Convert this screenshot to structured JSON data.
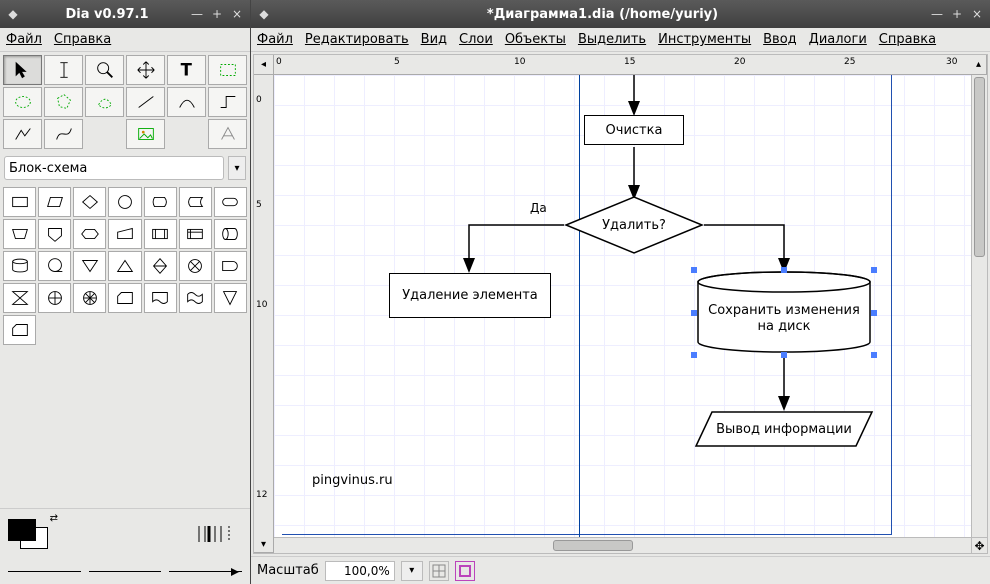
{
  "toolbox_window": {
    "title": "Dia v0.97.1",
    "menu": {
      "file": "Файл",
      "help": "Справка"
    },
    "sheet_name": "Блок-схема"
  },
  "canvas_window": {
    "title": "*Диаграмма1.dia (/home/yuriy)",
    "menu": {
      "file": "Файл",
      "edit": "Редактировать",
      "view": "Вид",
      "layers": "Слои",
      "objects": "Объекты",
      "select": "Выделить",
      "tools": "Инструменты",
      "input": "Ввод",
      "dialogs": "Диалоги",
      "help": "Справка"
    },
    "watermark": "pingvinus.ru",
    "hruler": [
      "0",
      "5",
      "10",
      "15",
      "20",
      "25",
      "30"
    ],
    "vruler": [
      "0",
      "5",
      "10",
      "12"
    ]
  },
  "diagram": {
    "process_clean": "Очистка",
    "decision_delete": "Удалить?",
    "decision_yes": "Да",
    "process_delete_elem": "Удаление элемента",
    "storage_save_line1": "Сохранить изменения",
    "storage_save_line2": "на диск",
    "output_info": "Вывод информации"
  },
  "status": {
    "zoom_label": "Масштаб",
    "zoom_value": "100,0%"
  }
}
